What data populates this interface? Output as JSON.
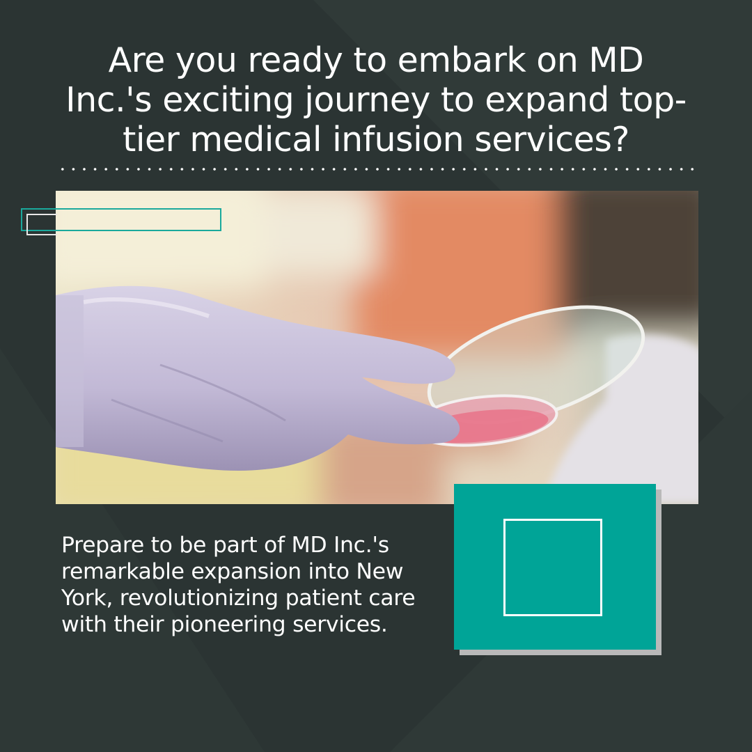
{
  "headline": "Are you ready to embark on MD Inc.'s exciting journey to expand top-tier medical infusion services?",
  "body": "Prepare to be part of MD Inc.'s remarkable expansion into New York, revolutionizing patient care with their pioneering services.",
  "photo": {
    "subject": "gloved hand holding petri dish"
  },
  "colors": {
    "background": "#2b3433",
    "background_light": "#303a38",
    "accent": "#00a497",
    "accent_outline": "#1aa99c",
    "text": "#ffffff",
    "shadow": "#b9b9b9"
  }
}
